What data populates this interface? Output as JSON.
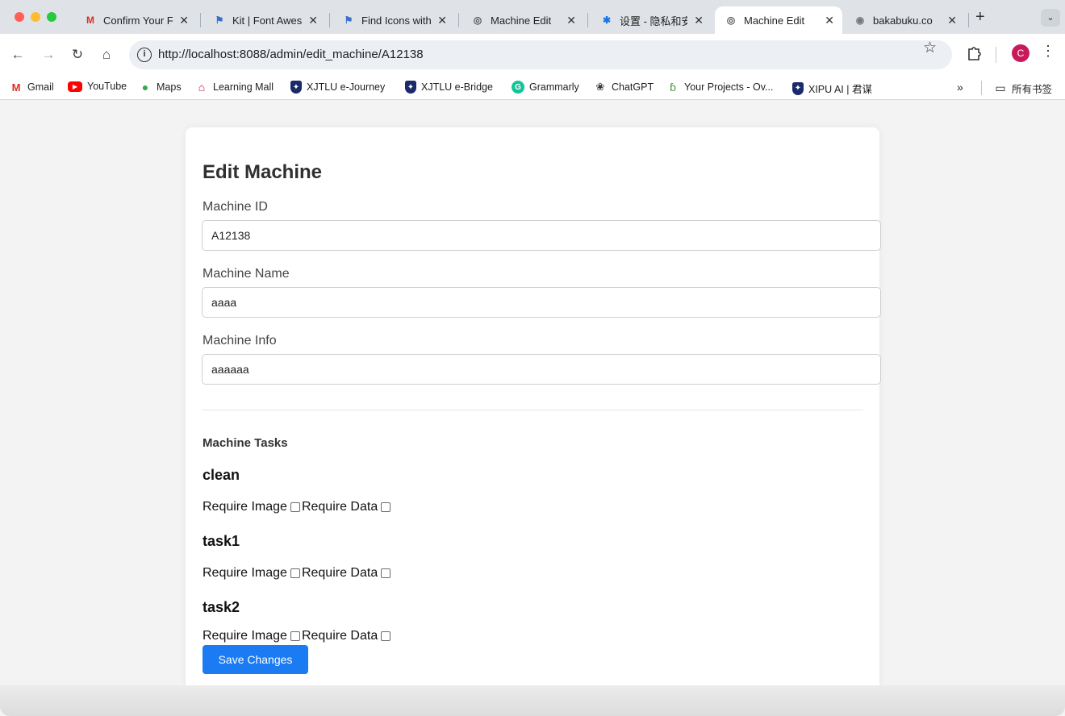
{
  "tabs": [
    {
      "title": "Confirm Your F",
      "icon": "gmail-icon"
    },
    {
      "title": "Kit | Font Awes",
      "icon": "font-awesome-icon"
    },
    {
      "title": "Find Icons with",
      "icon": "font-awesome-icon"
    },
    {
      "title": "Machine Edit",
      "icon": "globe-icon"
    },
    {
      "title": "设置 - 隐私和安",
      "icon": "gear-icon"
    },
    {
      "title": "Machine Edit",
      "icon": "globe-icon",
      "active": true
    },
    {
      "title": "bakabuku.co",
      "icon": "site-icon"
    }
  ],
  "toolbar": {
    "url_prefix": "http://",
    "url_host": "localhost",
    "url_rest": ":8088/admin/edit_machine/A12138",
    "profile_initial": "C"
  },
  "bookmarks": [
    {
      "label": "Gmail",
      "icon": "gmail-icon"
    },
    {
      "label": "YouTube",
      "icon": "youtube-icon"
    },
    {
      "label": "Maps",
      "icon": "maps-pin-icon"
    },
    {
      "label": "Learning Mall",
      "icon": "learning-mall-icon"
    },
    {
      "label": "XJTLU e-Journey",
      "icon": "xjtlu-shield-icon"
    },
    {
      "label": "XJTLU e-Bridge",
      "icon": "xjtlu-shield-icon"
    },
    {
      "label": "Grammarly",
      "icon": "grammarly-icon"
    },
    {
      "label": "ChatGPT",
      "icon": "chatgpt-icon"
    },
    {
      "label": "Your Projects - Ov...",
      "icon": "overleaf-icon"
    },
    {
      "label": "XIPU AI | 君谋",
      "icon": "xjtlu-shield-icon"
    }
  ],
  "bookmarks_folder": "所有书签",
  "form": {
    "title": "Edit Machine",
    "machine_id_label": "Machine ID",
    "machine_id_value": "A12138",
    "machine_name_label": "Machine Name",
    "machine_name_value": "aaaa",
    "machine_info_label": "Machine Info",
    "machine_info_value": "aaaaaa",
    "tasks_heading": "Machine Tasks",
    "require_image_label": "Require Image",
    "require_data_label": "Require Data",
    "tasks": [
      {
        "name": "clean",
        "require_image": false,
        "require_data": false
      },
      {
        "name": "task1",
        "require_image": false,
        "require_data": false
      },
      {
        "name": "task2",
        "require_image": false,
        "require_data": false
      }
    ],
    "save_label": "Save Changes"
  },
  "colors": {
    "primary_button": "#1a7bf2",
    "page_background": "#f3f3f3",
    "tabstrip_background": "#dfe3e7"
  }
}
